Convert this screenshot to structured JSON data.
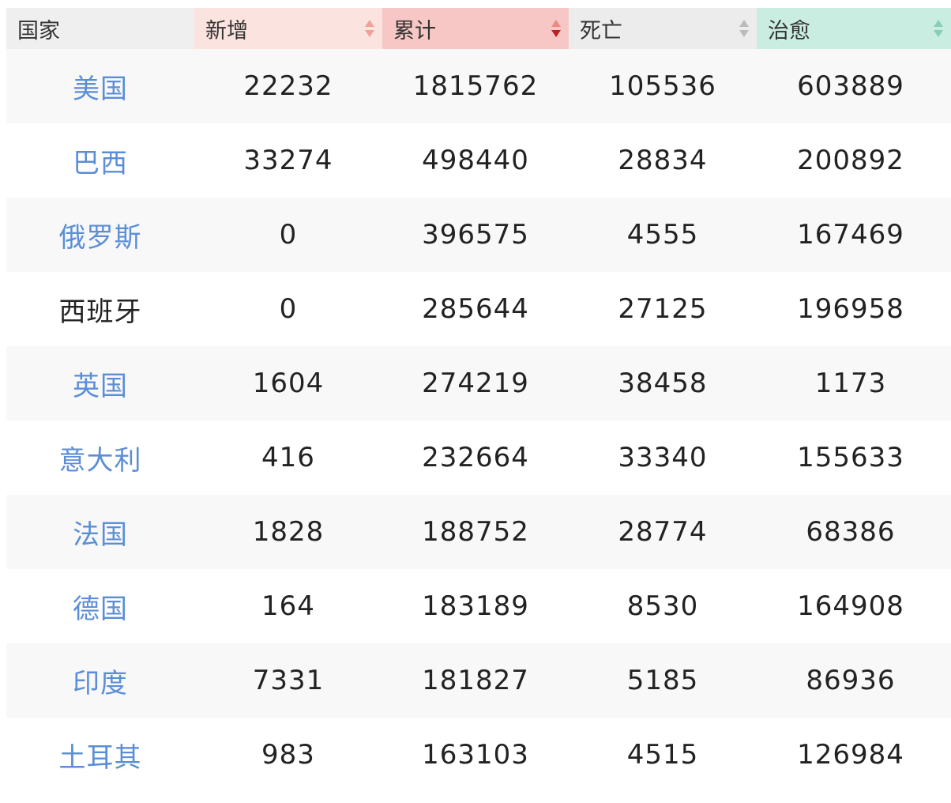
{
  "colors": {
    "link": "#5b8ed6",
    "header_country": "#efefef",
    "header_new": "#fbe3df",
    "header_total": "#f7c7c5",
    "header_deaths": "#ececec",
    "header_recovered": "#c9ede0",
    "sort_active": "#c0201b"
  },
  "sort": {
    "column": "total",
    "direction": "desc"
  },
  "headers": {
    "country": "国家",
    "new": "新增",
    "total": "累计",
    "deaths": "死亡",
    "recovered": "治愈"
  },
  "rows": [
    {
      "country": "美国",
      "linked": true,
      "new": "22232",
      "total": "1815762",
      "deaths": "105536",
      "recovered": "603889"
    },
    {
      "country": "巴西",
      "linked": true,
      "new": "33274",
      "total": "498440",
      "deaths": "28834",
      "recovered": "200892"
    },
    {
      "country": "俄罗斯",
      "linked": true,
      "new": "0",
      "total": "396575",
      "deaths": "4555",
      "recovered": "167469"
    },
    {
      "country": "西班牙",
      "linked": false,
      "new": "0",
      "total": "285644",
      "deaths": "27125",
      "recovered": "196958"
    },
    {
      "country": "英国",
      "linked": true,
      "new": "1604",
      "total": "274219",
      "deaths": "38458",
      "recovered": "1173"
    },
    {
      "country": "意大利",
      "linked": true,
      "new": "416",
      "total": "232664",
      "deaths": "33340",
      "recovered": "155633"
    },
    {
      "country": "法国",
      "linked": true,
      "new": "1828",
      "total": "188752",
      "deaths": "28774",
      "recovered": "68386"
    },
    {
      "country": "德国",
      "linked": true,
      "new": "164",
      "total": "183189",
      "deaths": "8530",
      "recovered": "164908"
    },
    {
      "country": "印度",
      "linked": true,
      "new": "7331",
      "total": "181827",
      "deaths": "5185",
      "recovered": "86936"
    },
    {
      "country": "土耳其",
      "linked": true,
      "new": "983",
      "total": "163103",
      "deaths": "4515",
      "recovered": "126984"
    }
  ]
}
